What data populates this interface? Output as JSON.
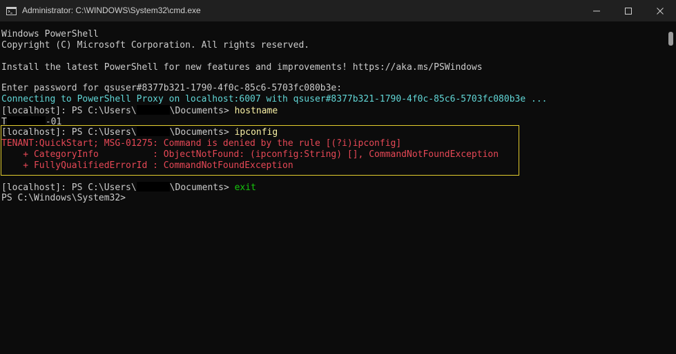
{
  "window": {
    "title": "Administrator: C:\\WINDOWS\\System32\\cmd.exe",
    "icons": {
      "app": "cmd-app-icon",
      "minimize": "minimize-icon",
      "maximize": "maximize-icon",
      "close": "close-icon"
    }
  },
  "console": {
    "lines": [
      "Windows PowerShell",
      "Copyright (C) Microsoft Corporation. All rights reserved.",
      "",
      "Install the latest PowerShell for new features and improvements! https://aka.ms/PSWindows",
      "",
      "Enter password for qsuser#8377b321-1790-4f0c-85c6-5703fc080b3e:",
      "Connecting to PowerShell Proxy on localhost:6007 with qsuser#8377b321-1790-4f0c-85c6-5703fc080b3e ...",
      "",
      "",
      "",
      "",
      "    + CategoryInfo          : ObjectNotFound: (ipconfig:String) [], CommandNotFoundException",
      "    + FullyQualifiedErrorId : CommandNotFoundException",
      "",
      "",
      "PS C:\\Windows\\System32>"
    ],
    "prompt_prefix": "[localhost]: PS C:\\Users\\",
    "prompt_suffix": "\\Documents> ",
    "cmd_hostname": "hostname",
    "hostname_prefix": "T",
    "hostname_suffix": "-01",
    "cmd_ipconfig": "ipconfig",
    "error_line": "TENANT:QuickStart; MSG-01275: Command is denied by the rule [(?i)ipconfig]",
    "cmd_exit": "exit"
  },
  "colors": {
    "background": "#0c0c0c",
    "titlebar": "#202020",
    "text": "#cccccc",
    "command": "#f9f1a5",
    "info": "#61d6d6",
    "error": "#e74856",
    "exit_command": "#16c60c",
    "highlight_border": "#e3cd2e"
  }
}
